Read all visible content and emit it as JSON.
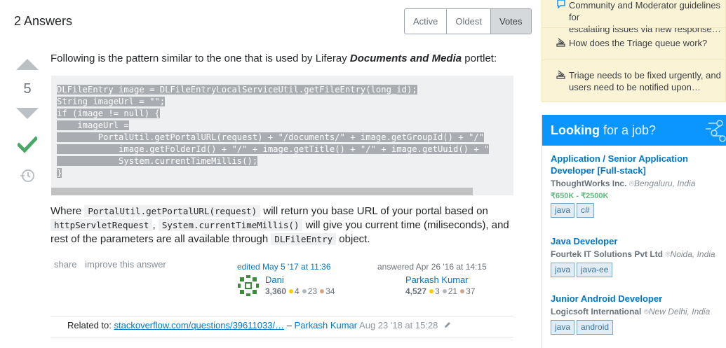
{
  "answers": {
    "count_label": "2 Answers",
    "sort_tabs": [
      {
        "label": "Active"
      },
      {
        "label": "Oldest"
      },
      {
        "label": "Votes"
      }
    ]
  },
  "answer": {
    "score": "5",
    "intro_before": "Following is the pattern similar to the one that is used by Liferay ",
    "intro_emph": "Documents and Media",
    "intro_after": " portlet:",
    "code_lines": [
      "DLFileEntry image = DLFileEntryLocalServiceUtil.getFileEntry(long_id);",
      "String imageUrl = \"\";",
      "if (image != null) {",
      "    imageUrl =",
      "        PortalUtil.getPortalURL(request) + \"/documents/\" + image.getGroupId() + \"/\"",
      "            image.getFolderId() + \"/\" + image.getTitle() + \"/\" + image.getUuid() + \"",
      "            System.currentTimeMillis();",
      "}"
    ],
    "para": {
      "t1": "Where ",
      "c1": "PortalUtil.getPortalURL(request)",
      "t2": " will return you base URL of your portal based on ",
      "c2": "httpServletRequest",
      "t3": ", ",
      "c3": "System.currentTimeMillis()",
      "t4": " will give you current time (miliseconds), and rest of the parameters are all available through ",
      "c4": "DLFileEntry",
      "t5": " object."
    },
    "menu": {
      "share": "share",
      "improve": "improve this answer"
    },
    "edited": {
      "action": "edited May 5 '17 at 11:36",
      "user": "Dani",
      "rep": "3,360",
      "gold": "4",
      "silver": "23",
      "bronze": "34"
    },
    "answered": {
      "action": "answered Apr 26 '16 at 14:15",
      "user": "Parkash Kumar",
      "rep": "4,527",
      "gold": "3",
      "silver": "21",
      "bronze": "37"
    },
    "comment": {
      "prefix": "Related to: ",
      "link": "stackoverflow.com/questions/39611033/…",
      "dash": " – ",
      "user": "Parkash Kumar",
      "date": "Aug 23 '18 at 15:28"
    }
  },
  "sidebar": {
    "meta_items": [
      {
        "text1": "Community and Moderator guidelines for",
        "text2": "escalating issues via new response…",
        "icon": "speech-bubble-icon"
      },
      {
        "text1": "How does the Triage queue work?",
        "text2": "",
        "icon": "stack-icon"
      },
      {
        "text1": "Triage needs to be fixed urgently, and",
        "text2": "users need to be notified upon…",
        "icon": "stack-icon"
      }
    ],
    "jobs_header": {
      "bold": "Looking",
      "rest": " for a job?"
    },
    "jobs": [
      {
        "title": "Application / Senior Application Developer [Full-stack]",
        "company": "ThoughtWorks Inc.",
        "location": "Bengaluru, India",
        "salary": "₹650K - ₹2500K",
        "tags": [
          "java",
          "c#"
        ]
      },
      {
        "title": "Java Developer",
        "company": "Fourtek IT Solutions Pvt Ltd",
        "location": "Noida, India",
        "salary": "",
        "tags": [
          "java",
          "java-ee"
        ]
      },
      {
        "title": "Junior Android Developer",
        "company": "Logicsoft International",
        "location": "New Delhi, India",
        "salary": "",
        "tags": [
          "java",
          "android"
        ]
      }
    ]
  },
  "colors": {
    "link": "#0077cc",
    "accepted": "#48a868",
    "gold": "#ffcc01",
    "silver": "#b4b8bc",
    "bronze": "#d1a684",
    "jobs_header": "#0a95ff"
  }
}
